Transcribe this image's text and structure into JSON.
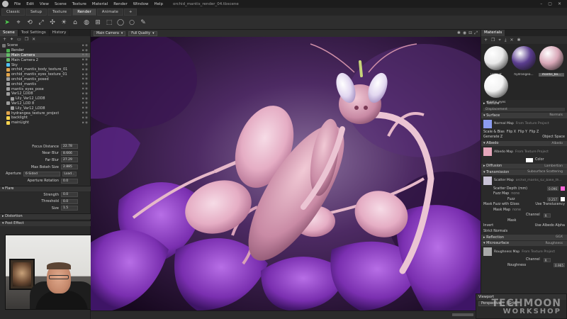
{
  "window": {
    "title": "orchid_mantis_render_04.tbscene",
    "menu": [
      "File",
      "Edit",
      "View",
      "Scene",
      "Texture",
      "Material",
      "Render",
      "Window",
      "Help"
    ],
    "controls": [
      "–",
      "▢",
      "✕"
    ]
  },
  "modes": [
    "Classic",
    "Setup",
    "Texture",
    "Render",
    "Animate",
    "+"
  ],
  "left_panel": {
    "tabs": [
      "Scene",
      "Tool Settings",
      "History"
    ],
    "tree": [
      {
        "label": "Scene",
        "color": "#777777",
        "indent": 0
      },
      {
        "label": "Render",
        "color": "#4caf50",
        "indent": 1
      },
      {
        "label": "Main Camera",
        "color": "#66bb6a",
        "indent": 1,
        "selected": true
      },
      {
        "label": "Main Camera 2",
        "color": "#66bb6a",
        "indent": 1
      },
      {
        "label": "Sky",
        "color": "#4fc3f7",
        "indent": 1
      },
      {
        "label": "orchid_mantis_body_texture_01",
        "color": "#e1a44b",
        "indent": 1
      },
      {
        "label": "orchid_mantis_eyes_texture_01",
        "color": "#e1a44b",
        "indent": 1
      },
      {
        "label": "orchid_mantis_posed",
        "color": "#9e9e9e",
        "indent": 1
      },
      {
        "label": "orchid_mantis",
        "color": "#9e9e9e",
        "indent": 1
      },
      {
        "label": "mantis_eyes_pose",
        "color": "#9e9e9e",
        "indent": 1
      },
      {
        "label": "Var12_LOD8",
        "color": "#9e9e9e",
        "indent": 1
      },
      {
        "label": "Lily_Var12_LOD8",
        "color": "#9e9e9e",
        "indent": 2
      },
      {
        "label": "Var12_LOD 8",
        "color": "#9e9e9e",
        "indent": 1
      },
      {
        "label": "Lily_Var12_LOD8",
        "color": "#9e9e9e",
        "indent": 2
      },
      {
        "label": "hydrangea_texture_project",
        "color": "#e1a44b",
        "indent": 1
      },
      {
        "label": "backlight",
        "color": "#ffd54f",
        "indent": 1
      },
      {
        "label": "mainLight",
        "color": "#ffd54f",
        "indent": 1
      }
    ],
    "camera_props": [
      {
        "label": "Focus Distance",
        "value": "22.78"
      },
      {
        "label": "Near Blur",
        "value": "8.666"
      },
      {
        "label": "Far Blur",
        "value": "27.29"
      },
      {
        "label": "Max Bokeh Size",
        "value": "2.885"
      }
    ],
    "aperture": {
      "label": "Aperture",
      "value": "6-Sided",
      "button": "Load..."
    },
    "aperture_rotation": {
      "label": "Aperture Rotation",
      "value": "0.0"
    },
    "flare": {
      "title": "Flare",
      "rows": [
        {
          "label": "Strength",
          "value": "0.0"
        },
        {
          "label": "Threshold",
          "value": "0.0"
        },
        {
          "label": "Size",
          "value": "1.5"
        }
      ]
    },
    "distortion_title": "Distortion",
    "post_effect_title": "Post Effect"
  },
  "viewport": {
    "camera": "Main Camera",
    "quality": "Full Quality",
    "mini_panel": {
      "title": "Viewport",
      "projection": "Perspective",
      "grid": "Grid"
    }
  },
  "right_panel": {
    "tab": "Materials",
    "materials": [
      {
        "label": "Default",
        "color": "#e8e8e8"
      },
      {
        "label": "hydrangea...",
        "color": "#5b3d8f"
      },
      {
        "label": "mantis_bo...",
        "color": "#d9a8b8",
        "selected": true
      },
      {
        "label": "mantis_eyes",
        "color": "#f2f2f2"
      }
    ],
    "texture_label": "Texture",
    "displacement": "Displacement",
    "surface": {
      "title": "Surface",
      "value": "Normals"
    },
    "normal_map": {
      "name": "Normal Map",
      "source": "From Texture Project"
    },
    "flip_row": [
      "Scale & Bias",
      "Flip X",
      "Flip Y",
      "Flip Z"
    ],
    "generate_row": [
      "Generate Z",
      "Object Space"
    ],
    "albedo": {
      "title": "Albedo",
      "value": "Albedo"
    },
    "albedo_map": {
      "name": "Albedo Map",
      "source": "From Texture Project",
      "color_label": "Color"
    },
    "diffusion": {
      "title": "Diffusion",
      "value": "Lambertian"
    },
    "transmission": {
      "title": "Transmission",
      "value": "Subsurface Scattering"
    },
    "scatter_map": {
      "name": "Scatter Map",
      "source": "orchid_mantis_02_bake_th..."
    },
    "scatter_depth": {
      "label": "Scatter Depth (mm)",
      "value": "0.096"
    },
    "fuzz_map": {
      "name": "Fuzz Map",
      "source": "none"
    },
    "fuzz": {
      "label": "Fuzz",
      "value": "0.257"
    },
    "mask_fuzz": [
      "Mask Fuzz with Gloss",
      "Use Translucency"
    ],
    "mask_map": {
      "name": "Mask Map",
      "source": "none"
    },
    "channel_label": "Channel",
    "channel_value": "R",
    "mask_label": "Mask",
    "invert_row": [
      "Invert",
      "Use Albedo Alpha"
    ],
    "strict_normals": "Strict Normals",
    "reflection": {
      "title": "Reflection",
      "value": "GGX"
    },
    "microsurface": {
      "title": "Microsurface",
      "value": "Roughness"
    },
    "roughness_map": {
      "name": "Roughness Map",
      "source": "From Texture Project"
    },
    "roughness": {
      "label": "Roughness",
      "value": "0.965"
    }
  },
  "watermark": {
    "line1": "TECHMOON",
    "line2": "WORKSHOP"
  }
}
